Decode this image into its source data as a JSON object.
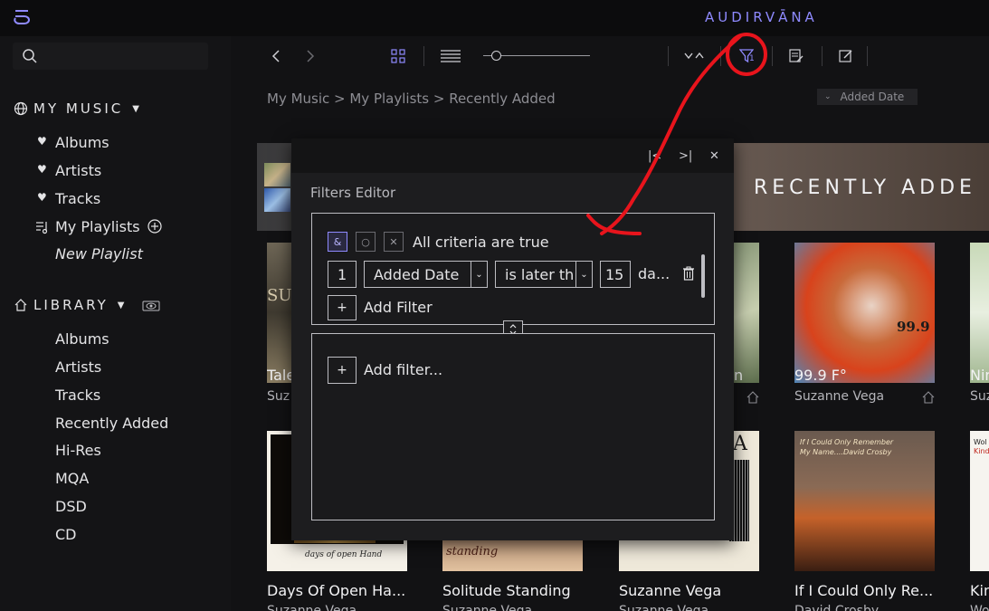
{
  "brand": "AUDIRVĀNA",
  "sidebar": {
    "my_music": {
      "title": "MY MUSIC",
      "items": [
        {
          "label": "Albums"
        },
        {
          "label": "Artists"
        },
        {
          "label": "Tracks"
        }
      ],
      "playlists": "My Playlists",
      "new_playlist": "New Playlist"
    },
    "library": {
      "title": "LIBRARY",
      "items": [
        {
          "label": "Albums"
        },
        {
          "label": "Artists"
        },
        {
          "label": "Tracks"
        },
        {
          "label": "Recently Added"
        },
        {
          "label": "Hi-Res"
        },
        {
          "label": "MQA"
        },
        {
          "label": "DSD"
        },
        {
          "label": "CD"
        }
      ]
    }
  },
  "toolbar": {
    "filter_count": "1"
  },
  "breadcrumb": "My Music > My Playlists > Recently Added",
  "sort": {
    "label": "Added Date"
  },
  "banner": {
    "title": "RECENTLY ADDE"
  },
  "albums": [
    {
      "title": "Tale",
      "artist": "Suz"
    },
    {
      "title": "99.9 F°",
      "artist": "Suzanne Vega"
    },
    {
      "title": "Nin",
      "artist": "Suz"
    },
    {
      "title": "Days Of Open Ha...",
      "artist": "Suzanne Vega"
    },
    {
      "title": "Solitude Standing",
      "artist": "Suzanne Vega"
    },
    {
      "title": "Suzanne Vega",
      "artist": "Suzanne Vega"
    },
    {
      "title": "If I Could Only Re...",
      "artist": "David Crosby"
    },
    {
      "title": "Kin",
      "artist": "Wo"
    }
  ],
  "cover_text": {
    "days": "days of open Hand",
    "solitude": "standing",
    "ifcould_1": "If I Could Only Remember",
    "ifcould_2": "My Name....David Crosby",
    "kin_1": "Wol",
    "kin_2": "Kind",
    "a99": "99.9",
    "suz": "SUZ",
    "vega": "A"
  },
  "filters": {
    "title": "Filters Editor",
    "head_buttons": [
      "|<",
      ">|",
      "✕"
    ],
    "mode_buttons": [
      "&",
      "○",
      "✕"
    ],
    "criteria_label": "All criteria are true",
    "row": {
      "index": "1",
      "field": "Added Date",
      "operator": "is later th",
      "value": "15",
      "unit": "da..."
    },
    "add_filter_partial": "Add Filter",
    "add_filter": "Add filter..."
  },
  "colors": {
    "accent": "#8f8aff",
    "annotation": "#e8141c"
  }
}
